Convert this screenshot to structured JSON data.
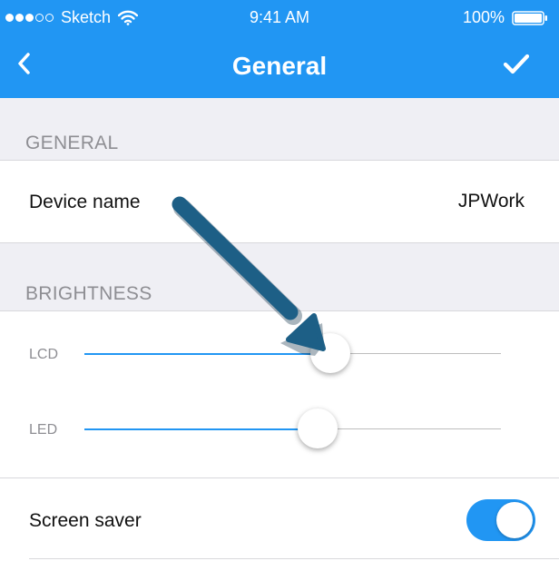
{
  "status_bar": {
    "carrier": "Sketch",
    "time": "9:41 AM",
    "battery": "100%",
    "signal_icon": "signal-dots-icon",
    "wifi_icon": "wifi-icon",
    "battery_icon": "battery-icon"
  },
  "nav": {
    "title": "General",
    "back_icon": "chevron-left-icon",
    "done_icon": "checkmark-icon"
  },
  "sections": {
    "general": {
      "header": "GENERAL",
      "device_name_label": "Device name",
      "device_name_value": "JPWork"
    },
    "brightness": {
      "header": "BRIGHTNESS",
      "lcd_label": "LCD",
      "lcd_level": 0.59,
      "led_label": "LED",
      "led_level": 0.56,
      "screen_saver_label": "Screen saver",
      "screen_saver_on": true
    }
  },
  "colors": {
    "accent": "#2196f3",
    "background": "#efeff4",
    "annotation_arrow": "#1d5f86"
  }
}
